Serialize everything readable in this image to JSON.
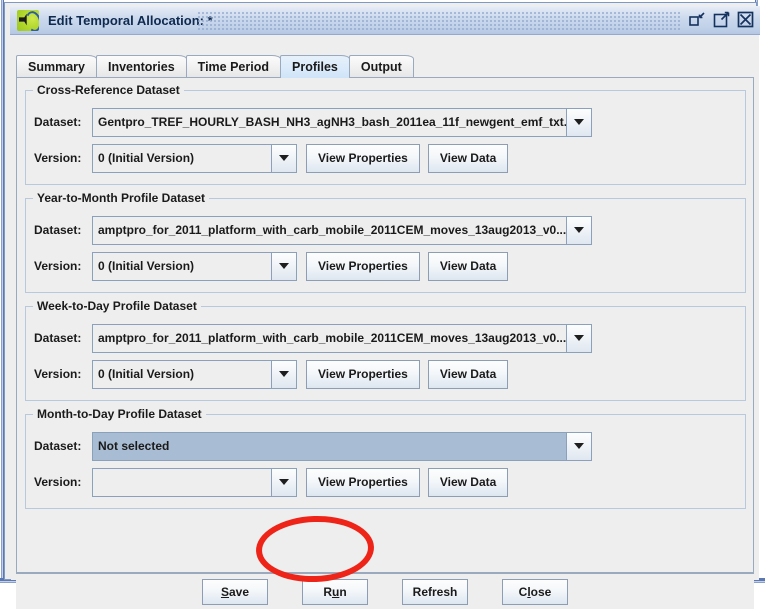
{
  "window": {
    "title": "Edit Temporal Allocation: *",
    "icon": "emf-app-icon",
    "controls": [
      {
        "name": "restore-button",
        "label": "Restore"
      },
      {
        "name": "maximize-button",
        "label": "Maximize"
      },
      {
        "name": "close-button",
        "label": "Close"
      }
    ]
  },
  "tabs": [
    {
      "label": "Summary",
      "selected": false
    },
    {
      "label": "Inventories",
      "selected": false
    },
    {
      "label": "Time Period",
      "selected": false
    },
    {
      "label": "Profiles",
      "selected": true
    },
    {
      "label": "Output",
      "selected": false
    }
  ],
  "labels": {
    "dataset": "Dataset:",
    "version": "Version:",
    "view_properties": "View Properties",
    "view_data": "View Data"
  },
  "groups": [
    {
      "title": "Cross-Reference Dataset",
      "dataset_value": "Gentpro_TREF_HOURLY_BASH_NH3_agNH3_bash_2011ea_11f_newgent_emf_txt...",
      "dataset_highlighted": false,
      "version_value": "0 (Initial Version)"
    },
    {
      "title": "Year-to-Month Profile Dataset",
      "dataset_value": "amptpro_for_2011_platform_with_carb_mobile_2011CEM_moves_13aug2013_v0...",
      "dataset_highlighted": false,
      "version_value": "0 (Initial Version)"
    },
    {
      "title": "Week-to-Day Profile Dataset",
      "dataset_value": "amptpro_for_2011_platform_with_carb_mobile_2011CEM_moves_13aug2013_v0...",
      "dataset_highlighted": false,
      "version_value": "0 (Initial Version)"
    },
    {
      "title": "Month-to-Day Profile Dataset",
      "dataset_value": "Not selected",
      "dataset_highlighted": true,
      "version_value": ""
    }
  ],
  "bottom_buttons": [
    {
      "name": "save-button",
      "pre": "",
      "mnemonic": "S",
      "post": "ave"
    },
    {
      "name": "run-button",
      "pre": "R",
      "mnemonic": "u",
      "post": "n"
    },
    {
      "name": "refresh-button",
      "pre": "Refresh",
      "mnemonic": "",
      "post": ""
    },
    {
      "name": "close-button",
      "pre": "C",
      "mnemonic": "l",
      "post": "ose"
    }
  ],
  "annotation": {
    "type": "ellipse",
    "color": "#ee2418",
    "target": "run-button"
  },
  "colors": {
    "window_border": "#5b78b5",
    "panel_background": "#eeeeee",
    "tab_selected": "#d9eafa",
    "combo_highlight": "#a8bcd3",
    "annotation_red": "#ee2418"
  }
}
